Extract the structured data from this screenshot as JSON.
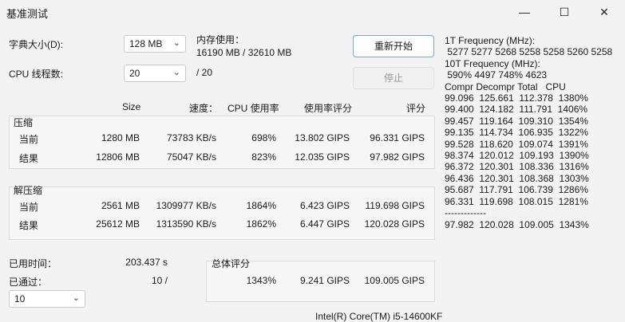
{
  "window": {
    "title": "基准测试",
    "minimize_glyph": "—",
    "maximize_glyph": "☐",
    "close_glyph": "✕"
  },
  "settings": {
    "dict_label": "字典大小(D):",
    "dict_value": "128 MB",
    "threads_label": "CPU 线程数:",
    "threads_value": "20",
    "threads_max": "/ 20",
    "memory_label": "内存使用：",
    "memory_value": "16190 MB / 32610 MB"
  },
  "buttons": {
    "restart": "重新开始",
    "stop": "停止"
  },
  "table": {
    "headers": {
      "size": "Size",
      "speed": "速度：",
      "cpu": "CPU 使用率",
      "rating": "使用率评分",
      "score": "评分"
    },
    "compress": {
      "title": "压缩",
      "current": {
        "label": "当前",
        "size": "1280 MB",
        "speed": "73783 KB/s",
        "cpu": "698%",
        "rating": "13.802 GIPS",
        "score": "96.331 GIPS"
      },
      "result": {
        "label": "结果",
        "size": "12806 MB",
        "speed": "75047 KB/s",
        "cpu": "823%",
        "rating": "12.035 GIPS",
        "score": "97.982 GIPS"
      }
    },
    "decompress": {
      "title": "解压缩",
      "current": {
        "label": "当前",
        "size": "2561 MB",
        "speed": "1309977 KB/s",
        "cpu": "1864%",
        "rating": "6.423 GIPS",
        "score": "119.698 GIPS"
      },
      "result": {
        "label": "结果",
        "size": "25612 MB",
        "speed": "1313590 KB/s",
        "cpu": "1862%",
        "rating": "6.447 GIPS",
        "score": "120.028 GIPS"
      }
    }
  },
  "footer": {
    "elapsed_label": "已用时间：",
    "elapsed_value": "203.437 s",
    "passed_label": "已通过：",
    "passed_value": "10 /",
    "passes_select": "10",
    "total_label": "总体评分",
    "total_cpu": "1343%",
    "total_rating": "9.241 GIPS",
    "total_score": "109.005 GIPS",
    "cpu_name": "Intel(R) Core(TM) i5-14600KF"
  },
  "freq_log": "1T Frequency (MHz):\n 5277 5277 5268 5258 5258 5260 5258\n10T Frequency (MHz):\n 590% 4497 748% 4623\nCompr Decompr Total   CPU\n99.096  125.661  112.378  1380%\n99.400  124.182  111.791  1406%\n99.457  119.164  109.310  1354%\n99.135  114.734  106.935  1322%\n99.528  118.620  109.074  1391%\n98.374  120.012  109.193  1390%\n96.372  120.301  108.336  1316%\n96.436  120.301  108.368  1303%\n95.687  117.791  106.739  1286%\n96.331  119.698  108.015  1281%\n-------------\n97.982  120.028  109.005  1343%"
}
